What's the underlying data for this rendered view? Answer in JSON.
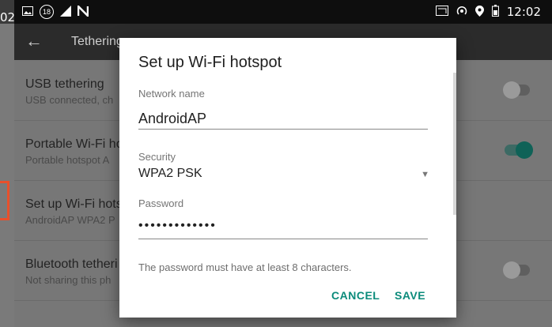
{
  "left_strip": {
    "time": "02"
  },
  "status_bar": {
    "left_icons": [
      "gallery-icon",
      "notification-count-icon",
      "signal-icon",
      "nfc-icon"
    ],
    "notification_count": "18",
    "right_icons": [
      "cast-icon",
      "hotspot-icon",
      "location-icon",
      "battery-icon"
    ],
    "time": "12:02"
  },
  "toolbar": {
    "title": "Tethering"
  },
  "list": {
    "items": [
      {
        "title": "USB tethering",
        "subtitle": "USB connected, ch",
        "toggle": "off"
      },
      {
        "title": "Portable Wi-Fi ho",
        "subtitle": "Portable hotspot A",
        "toggle": "on"
      },
      {
        "title": "Set up Wi-Fi hots",
        "subtitle": "AndroidAP WPA2 P",
        "toggle": ""
      },
      {
        "title": "Bluetooth tetheri",
        "subtitle": "Not sharing this ph",
        "toggle": "off"
      }
    ]
  },
  "dialog": {
    "title": "Set up Wi-Fi hotspot",
    "network_name_label": "Network name",
    "network_name_value": "AndroidAP",
    "security_label": "Security",
    "security_value": "WPA2 PSK",
    "password_label": "Password",
    "password_value": "•••••••••••••",
    "hint": "The password must have at least 8 characters.",
    "cancel_label": "CANCEL",
    "save_label": "SAVE"
  },
  "colors": {
    "accent": "#0b8b7b",
    "highlight": "#e8502b"
  }
}
